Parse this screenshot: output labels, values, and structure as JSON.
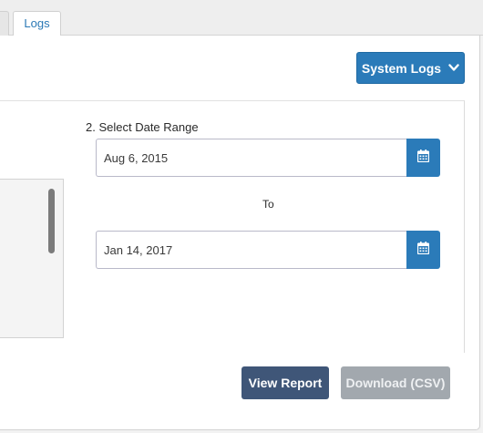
{
  "tabs": {
    "active_label": "Logs"
  },
  "header": {
    "system_logs_label": "System Logs"
  },
  "date_range": {
    "label": "2. Select Date Range",
    "start_value": "Aug 6, 2015",
    "separator": "To",
    "end_value": "Jan 14, 2017"
  },
  "actions": {
    "view_report_label": "View Report",
    "download_label": "Download (CSV)"
  },
  "icons": {
    "dropdown": "chevron-down-icon",
    "calendar": "calendar-icon"
  },
  "colors": {
    "primary": "#2b7bb9",
    "view_button": "#3f5678",
    "disabled_button": "#a2a8ae",
    "tab_text": "#2a78b5"
  }
}
